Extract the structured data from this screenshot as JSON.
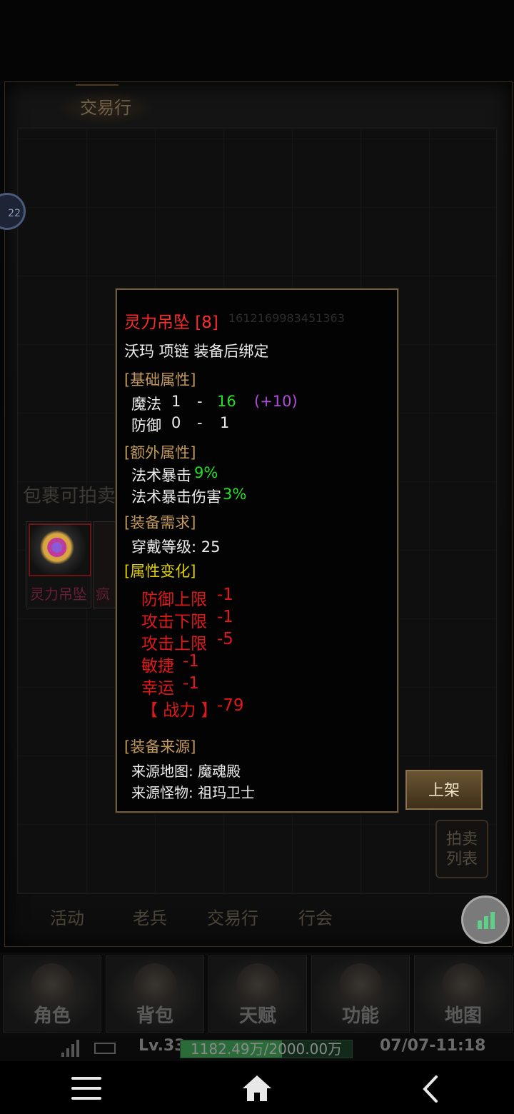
{
  "window": {
    "title": "交易行",
    "side_badge": "22"
  },
  "bag": {
    "label": "包裹可拍卖",
    "slots": [
      {
        "name": "灵力吊坠"
      },
      {
        "name": "疯"
      }
    ]
  },
  "buttons": {
    "shelf": "上架",
    "auction_list_line1": "拍卖",
    "auction_list_line2": "列表"
  },
  "tabs": [
    "活动",
    "老兵",
    "交易行",
    "行会"
  ],
  "tooltip": {
    "item_name": "灵力吊坠 [8]",
    "item_id": "1612169983451363",
    "info": "沃玛 项链 装备后绑定",
    "sections": {
      "base": "[基础属性]",
      "extra": "[额外属性]",
      "req": "[装备需求]",
      "change": "[属性变化]",
      "source": "[装备来源]"
    },
    "base_attrs": [
      {
        "name": "魔法",
        "min": "1",
        "dash": "-",
        "max": "16",
        "bonus": "(+10)"
      },
      {
        "name": "防御",
        "min": "0",
        "dash": "-",
        "max": "1"
      }
    ],
    "extra_attrs": [
      {
        "name": "法术暴击",
        "value": "9%"
      },
      {
        "name": "法术暴击伤害",
        "value": "3%"
      }
    ],
    "requirement": "穿戴等级: 25",
    "changes": [
      {
        "name": "防御上限",
        "value": "-1"
      },
      {
        "name": "攻击下限",
        "value": "-1"
      },
      {
        "name": "攻击上限",
        "value": "-5"
      },
      {
        "name": "敏捷",
        "value": "-1"
      },
      {
        "name": "幸运",
        "value": "-1"
      },
      {
        "name": "【 战力 】",
        "value": "-79"
      }
    ],
    "source_map": "来源地图:  魔魂殿",
    "source_monster": "来源怪物:  祖玛卫士"
  },
  "game_nav": [
    "角色",
    "背包",
    "天赋",
    "功能",
    "地图"
  ],
  "status": {
    "level": "Lv.33",
    "exp_text": "1182.49万/2000.00万",
    "exp_fraction": 0.59,
    "time": "07/07-11:18"
  },
  "icons": [
    "signal-icon",
    "battery-icon",
    "stats-icon",
    "menu-icon",
    "home-icon",
    "back-icon"
  ]
}
